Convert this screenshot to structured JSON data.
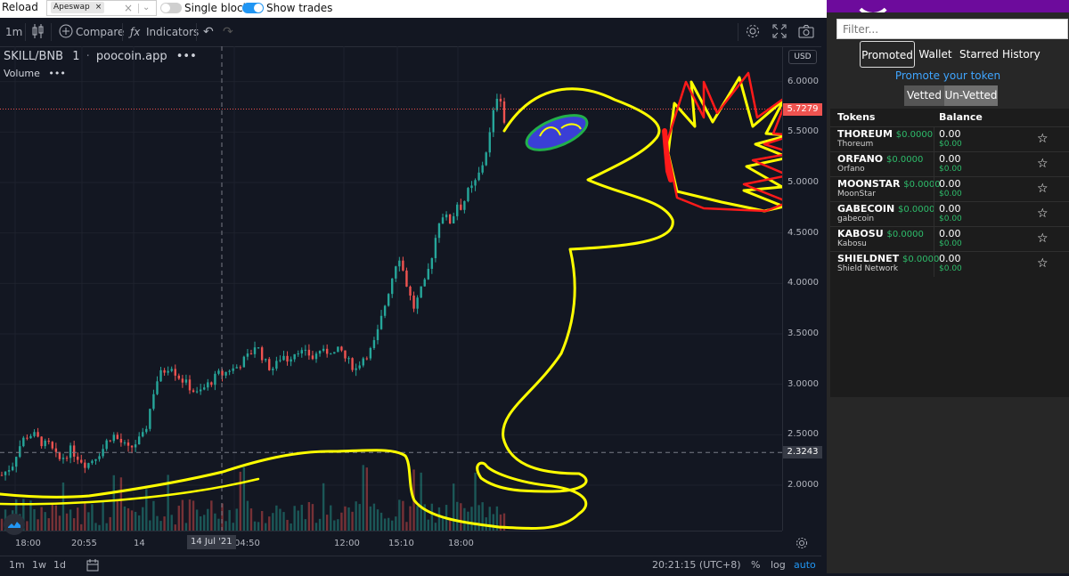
{
  "topbar": {
    "reload_label": "Reload",
    "dex_tag": "Apeswap",
    "dex_tag_remove": "×",
    "dex_clear": "×",
    "dex_caret": "⌄",
    "single_blocks_label": "Single blocks",
    "single_blocks_on": false,
    "show_trades_label": "Show trades",
    "show_trades_on": true
  },
  "toolbar": {
    "interval": "1m",
    "compare_label": "Compare",
    "indicators_label": "Indicators",
    "undo": "↶",
    "redo": "↷"
  },
  "legend": {
    "symbol": "SKILL/BNB",
    "interval": "1",
    "source": "poocoin.app",
    "menu": "•••",
    "volume_label": "Volume"
  },
  "y_axis": {
    "currency_button": "USD",
    "labels": [
      "6.0000",
      "5.5000",
      "5.0000",
      "4.5000",
      "4.0000",
      "3.5000",
      "3.0000",
      "2.5000",
      "2.0000"
    ],
    "current_price": "5.7279",
    "crosshair_price": "2.3243"
  },
  "x_axis": {
    "labels": [
      "18:00",
      "20:55",
      "14",
      "04:50",
      "12:00",
      "15:10",
      "18:00"
    ],
    "crosshair_label": "14 Jul '21"
  },
  "bottom_bar": {
    "ranges": [
      "1m",
      "1w",
      "1d"
    ],
    "time": "20:21:15 (UTC+8)",
    "percent": "%",
    "log": "log",
    "auto": "auto"
  },
  "right_panel": {
    "filter_placeholder": "Filter...",
    "tabs": [
      "Promoted",
      "Wallet",
      "Starred",
      "History"
    ],
    "active_tab": "Promoted",
    "promote_link": "Promote your token",
    "vet_buttons": [
      "Vetted",
      "Un-Vetted"
    ],
    "table_headers": {
      "tokens": "Tokens",
      "balance": "Balance"
    },
    "tokens": [
      {
        "symbol": "THOREUM",
        "price": "$0.0000",
        "name": "Thoreum",
        "balance": "0.00",
        "balance_usd": "$0.00"
      },
      {
        "symbol": "ORFANO",
        "price": "$0.0000",
        "name": "Orfano",
        "balance": "0.00",
        "balance_usd": "$0.00"
      },
      {
        "symbol": "MOONSTAR",
        "price": "$0.0000",
        "name": "MoonStar",
        "balance": "0.00",
        "balance_usd": "$0.00"
      },
      {
        "symbol": "GABECOIN",
        "price": "$0.0000",
        "name": "gabecoin",
        "balance": "0.00",
        "balance_usd": "$0.00"
      },
      {
        "symbol": "KABOSU",
        "price": "$0.0000",
        "name": "Kabosu",
        "balance": "0.00",
        "balance_usd": "$0.00"
      },
      {
        "symbol": "SHIELDNET",
        "price": "$0.0000",
        "name": "Shield Network",
        "balance": "0.00",
        "balance_usd": "$0.00"
      }
    ],
    "star_glyph": "☆"
  },
  "colors": {
    "up": "#26a69a",
    "down": "#ef5350",
    "panel_bg": "#272727",
    "accent_purple": "#6d0b9c",
    "link_blue": "#3fa5ff",
    "drawing_yellow": "#ffff00",
    "drawing_red": "#ff1a1a",
    "drawing_blue": "#3a3fd6",
    "drawing_green": "#22b04a"
  },
  "chart_data": {
    "type": "candlestick",
    "title": "SKILL/BNB",
    "ylabel": "",
    "xlabel": "",
    "ylim": [
      1.55,
      6.35
    ],
    "x": [
      "18:00",
      "20:55",
      "14",
      "04:50",
      "12:00",
      "15:10",
      "18:00"
    ],
    "close_path": [
      2.1,
      2.15,
      2.2,
      2.35,
      2.45,
      2.5,
      2.5,
      2.45,
      2.4,
      2.4,
      2.3,
      2.25,
      2.3,
      2.35,
      2.3,
      2.25,
      2.2,
      2.25,
      2.3,
      2.35,
      2.45,
      2.5,
      2.45,
      2.4,
      2.35,
      2.4,
      2.45,
      2.5,
      2.75,
      3.0,
      3.1,
      3.15,
      3.2,
      3.1,
      3.05,
      3.0,
      2.95,
      2.9,
      2.95,
      3.0,
      3.05,
      3.1,
      3.1,
      3.15,
      3.15,
      3.2,
      3.25,
      3.3,
      3.4,
      3.3,
      3.2,
      3.15,
      3.2,
      3.3,
      3.25,
      3.3,
      3.35,
      3.3,
      3.3,
      3.25,
      3.35,
      3.3,
      3.35,
      3.3,
      3.35,
      3.25,
      3.2,
      3.15,
      3.25,
      3.3,
      3.35,
      3.5,
      3.7,
      3.9,
      4.1,
      4.3,
      4.1,
      3.9,
      3.75,
      3.9,
      4.0,
      4.2,
      4.45,
      4.7,
      4.65,
      4.6,
      4.8,
      4.75,
      4.9,
      4.95,
      5.05,
      5.2,
      5.4,
      5.7,
      5.95,
      5.6
    ],
    "current_price": 5.7279,
    "crosshair_price": 2.3243
  }
}
